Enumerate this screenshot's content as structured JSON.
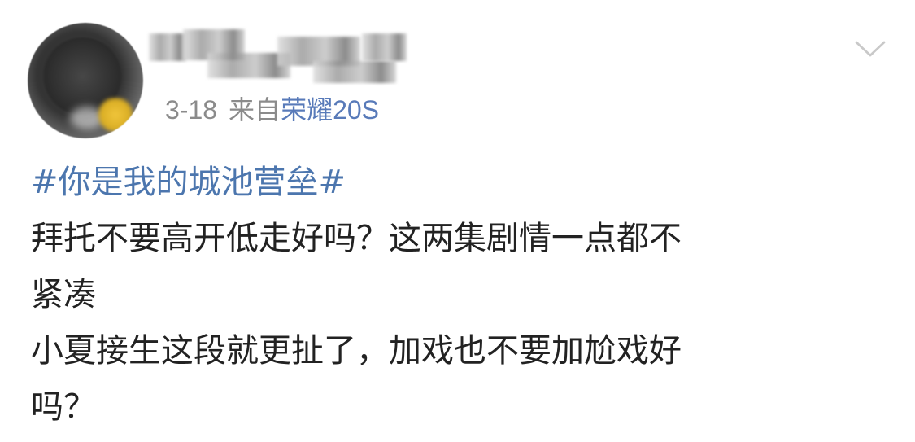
{
  "post": {
    "timestamp": "3-18",
    "source_label": "来自",
    "source_device": "荣耀20S",
    "hashtag": "#你是我的城池营垒#",
    "text_lines": [
      "拜托不要高开低走好吗？这两集剧情一点都不",
      "紧凑",
      "小夏接生这段就更扯了，加戏也不要加尬戏好",
      "吗？"
    ]
  },
  "icons": {
    "more": "chevron-down-icon",
    "avatar": "avatar"
  },
  "colors": {
    "link_blue": "#4c76ae",
    "meta_gray": "#8b8b8b",
    "text_dark": "#222222",
    "device_blue": "#587ab9"
  }
}
